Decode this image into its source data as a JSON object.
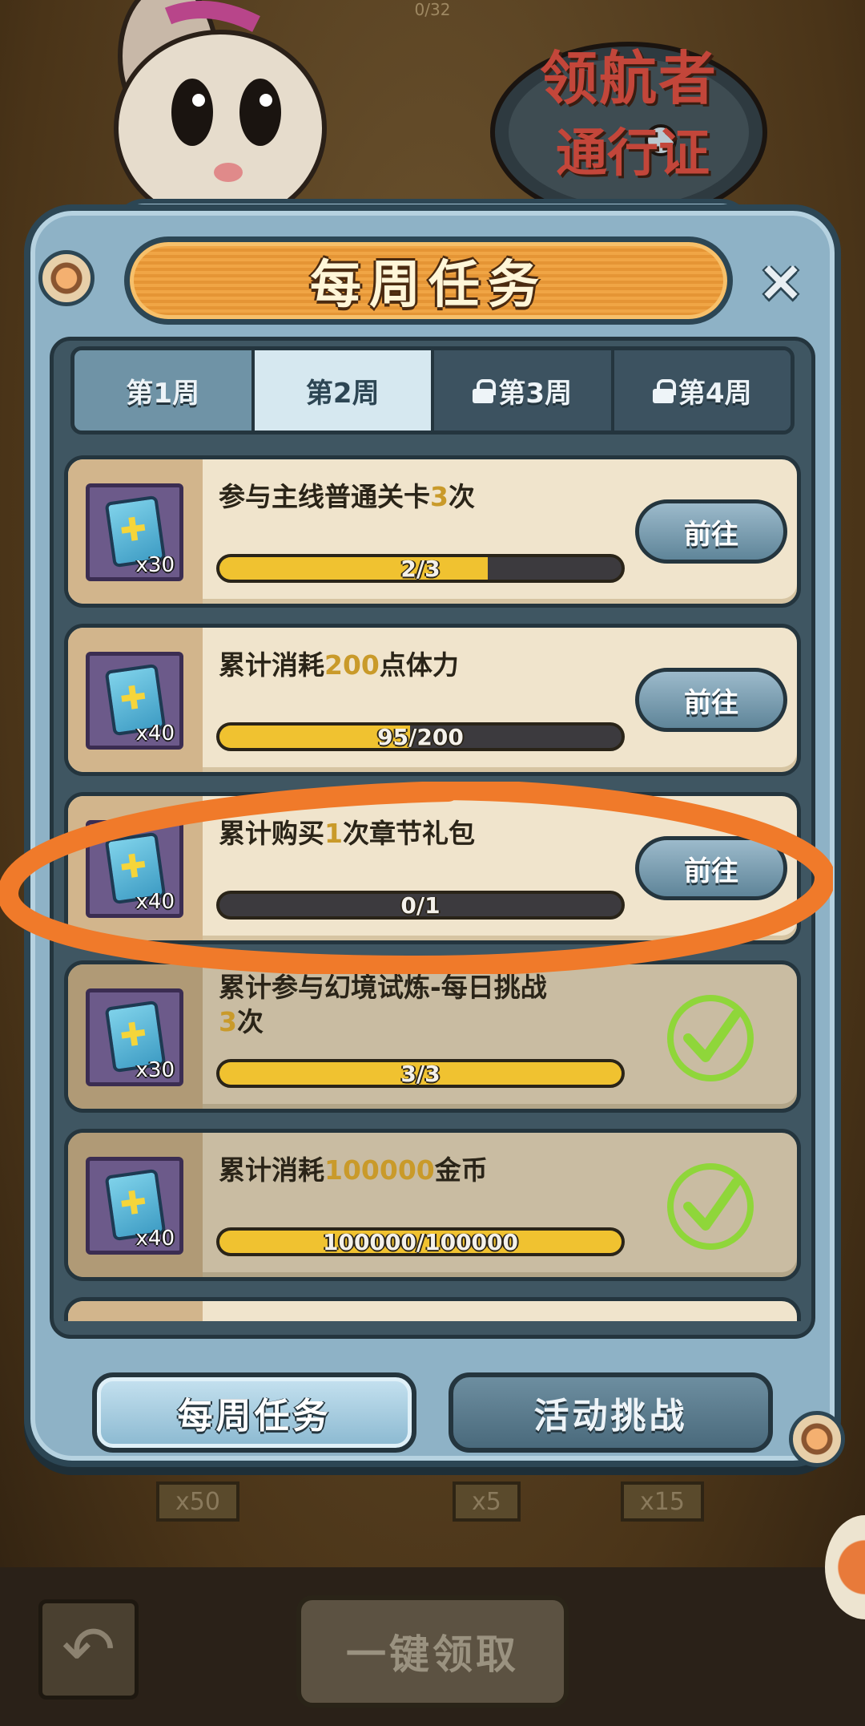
{
  "header": {
    "top_counter": "0/32",
    "pass_logo_line1": "领航者",
    "pass_logo_line2": "通行证",
    "title": "每周任务",
    "close_label": "×"
  },
  "tabs": [
    {
      "label": "第1周",
      "state": "unlocked"
    },
    {
      "label": "第2周",
      "state": "active"
    },
    {
      "label": "第3周",
      "state": "locked"
    },
    {
      "label": "第4周",
      "state": "locked"
    }
  ],
  "tasks": [
    {
      "title_pre": "参与主线普通关卡",
      "title_hl": "3",
      "title_post": "次",
      "reward_qty": "x30",
      "progress_text": "2/3",
      "progress": 0.667,
      "status": "go",
      "button_label": "前往"
    },
    {
      "title_pre": "累计消耗",
      "title_hl": "200",
      "title_post": "点体力",
      "reward_qty": "x40",
      "progress_text": "95/200",
      "progress": 0.475,
      "status": "go",
      "button_label": "前往"
    },
    {
      "title_pre": "累计购买",
      "title_hl": "1",
      "title_post": "次章节礼包",
      "reward_qty": "x40",
      "progress_text": "0/1",
      "progress": 0,
      "status": "go",
      "button_label": "前往"
    },
    {
      "title_pre": "累计参与幻境试炼-每日挑战",
      "title_hl": "3",
      "title_post": "次",
      "reward_qty": "x30",
      "progress_text": "3/3",
      "progress": 1,
      "status": "done"
    },
    {
      "title_pre": "累计消耗",
      "title_hl": "100000",
      "title_post": "金币",
      "reward_qty": "x40",
      "progress_text": "100000/100000",
      "progress": 1,
      "status": "done"
    }
  ],
  "bottom_tabs": {
    "weekly": "每周任务",
    "challenge": "活动挑战"
  },
  "peek_badges": [
    "x50",
    "x5",
    "x15"
  ],
  "footer": {
    "back_icon": "back-arrow-icon",
    "claim_all": "一键领取"
  },
  "colors": {
    "accent_orange": "#f0a545",
    "progress_yellow": "#f0c230",
    "highlight_ring": "#f07a2a",
    "check_green": "#8fd63a"
  }
}
